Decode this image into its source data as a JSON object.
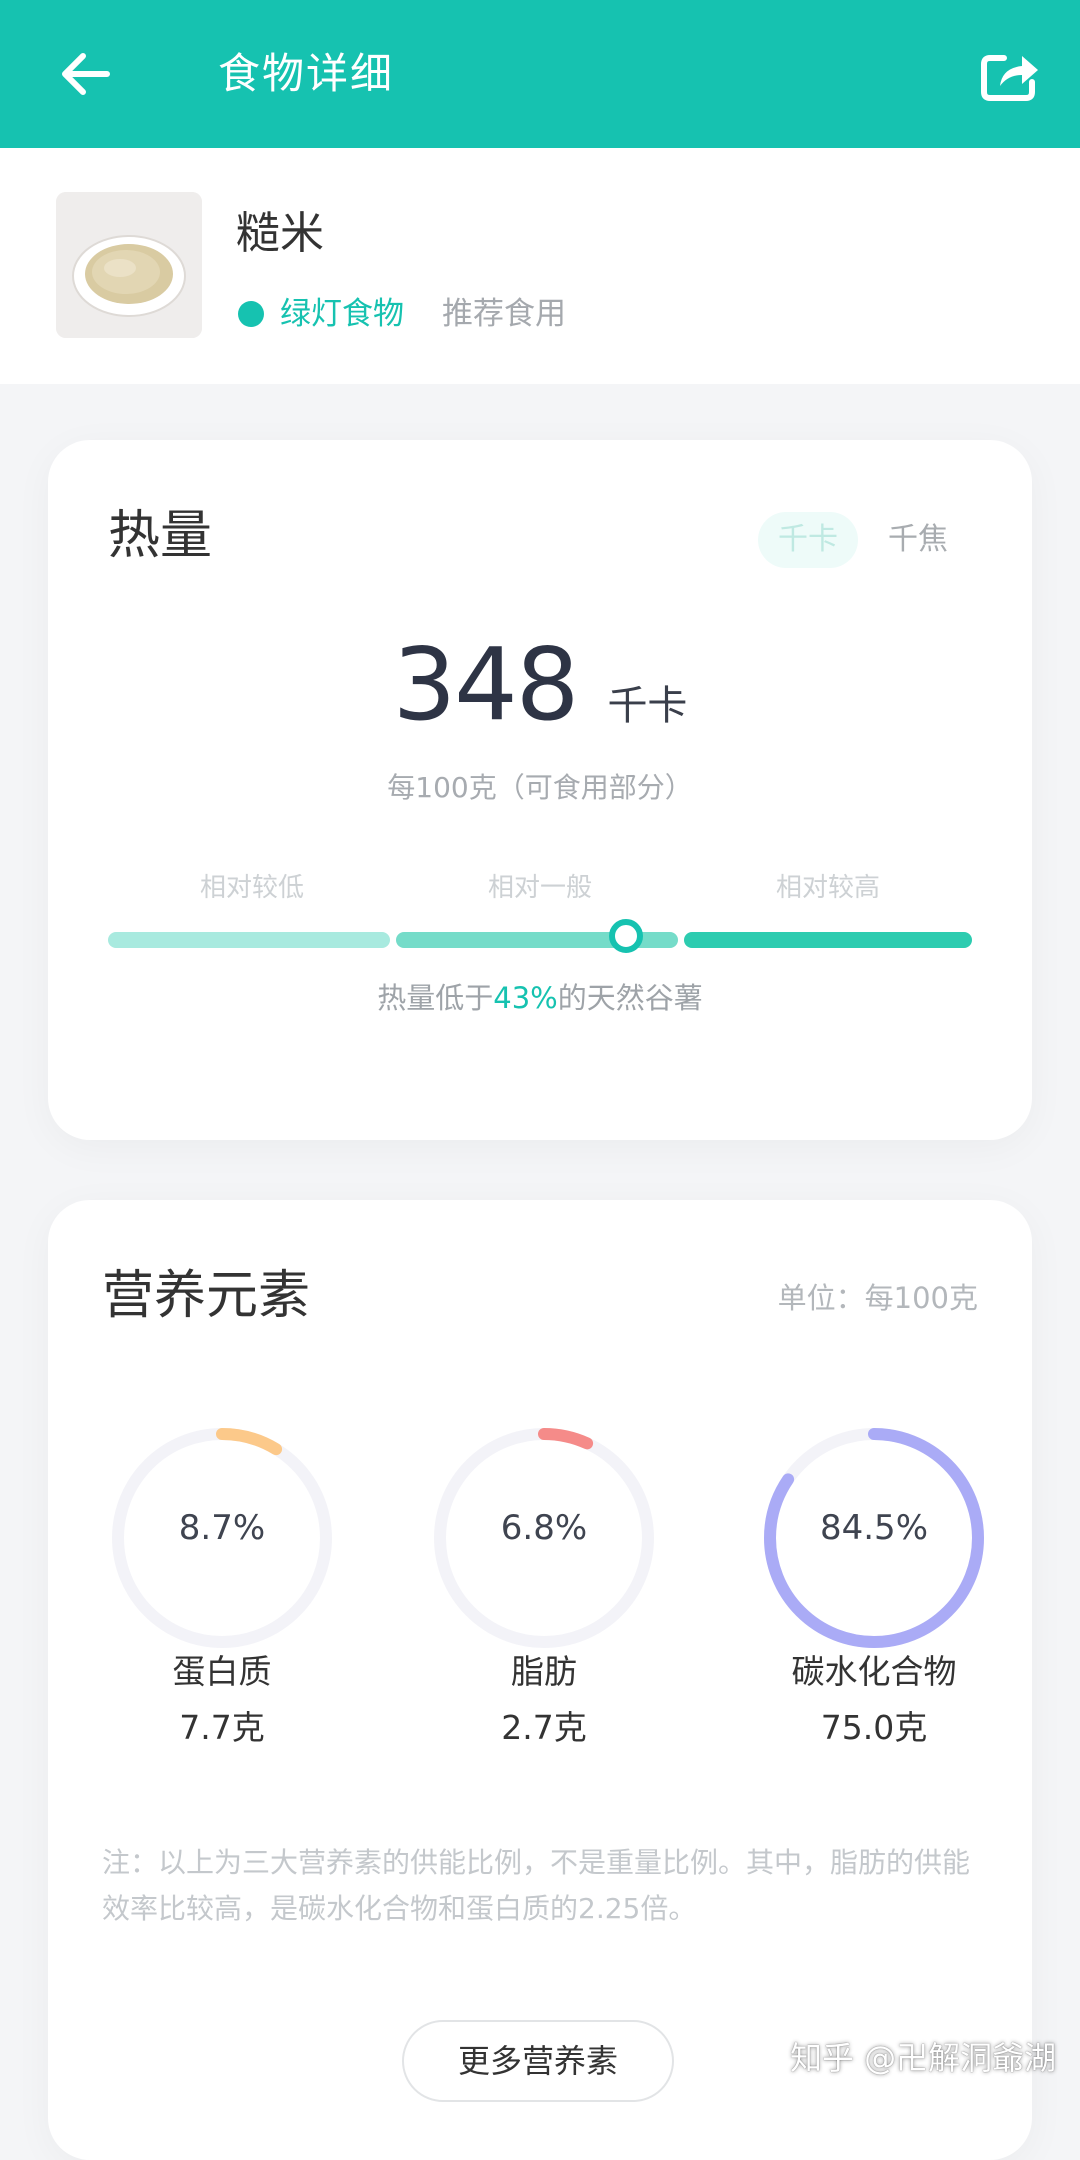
{
  "appbar": {
    "title": "食物详细",
    "back_icon": "arrow-left-icon",
    "share_icon": "share-icon"
  },
  "food": {
    "name": "糙米",
    "status_label": "绿灯食物",
    "recommend_label": "推荐食用"
  },
  "calorie": {
    "title": "热量",
    "unit_options": [
      "千卡",
      "千焦"
    ],
    "selected_unit": "千卡",
    "value": "348",
    "unit": "千卡",
    "per_note": "每100克（可食用部分）",
    "scale_labels": [
      "相对较低",
      "相对一般",
      "相对较高"
    ],
    "scale_position": 0.6,
    "compare_prefix": "热量低于",
    "compare_pct": "43%",
    "compare_suffix": "的天然谷薯"
  },
  "nutrients": {
    "title": "营养元素",
    "unit_note": "单位：每100克",
    "items": [
      {
        "pct_label": "8.7%",
        "pct": 8.7,
        "name": "蛋白质",
        "amount": "7.7克",
        "color": "#fcc98a"
      },
      {
        "pct_label": "6.8%",
        "pct": 6.8,
        "name": "脂肪",
        "amount": "2.7克",
        "color": "#f58b89"
      },
      {
        "pct_label": "84.5%",
        "pct": 84.5,
        "name": "碳水化合物",
        "amount": "75.0克",
        "color": "#aaabf6"
      }
    ],
    "footnote": "注：以上为三大营养素的供能比例，不是重量比例。其中，脂肪的供能效率比较高，是碳水化合物和蛋白质的2.25倍。",
    "more_button": "更多营养素"
  },
  "watermark": "知乎 @卍解洞爺湖",
  "colors": {
    "primary": "#16c2b0",
    "ring_track": "#f3f3f8"
  }
}
